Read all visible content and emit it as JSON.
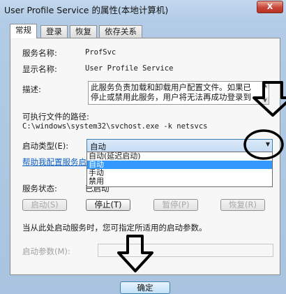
{
  "window": {
    "title": "User Profile Service 的属性(本地计算机)",
    "close_glyph": "X"
  },
  "tabs": [
    {
      "label": "常规",
      "active": true
    },
    {
      "label": "登录",
      "active": false
    },
    {
      "label": "恢复",
      "active": false
    },
    {
      "label": "依存关系",
      "active": false
    }
  ],
  "general": {
    "service_name_label": "服务名称:",
    "service_name_value": "ProfSvc",
    "display_name_label": "显示名称:",
    "display_name_value": "User Profile Service",
    "description_label": "描述:",
    "description_lines": [
      "此服务负责加载和卸载用户配置文件。如果已",
      "停止或禁用此服务，用户将无法再成功登录到"
    ],
    "exe_path_label": "可执行文件的路径:",
    "exe_path_value": "C:\\windows\\system32\\svchost.exe -k netsvcs",
    "startup_type_label": "启动类型(E):",
    "startup_type_value": "自动",
    "startup_options": [
      "自动(延迟启动)",
      "自动",
      "手动",
      "禁用"
    ],
    "startup_highlighted_index": 1,
    "help_link": "帮助我配置服务启动",
    "status_label": "服务状态:",
    "status_value": "已启动",
    "buttons": {
      "start": "启动(S)",
      "stop": "停止(T)",
      "pause": "暂停(P)",
      "resume": "恢复(R)"
    },
    "hint": "当从此处启动服务时，您可指定所适用的启动参数。",
    "params_label": "启动参数(M):",
    "params_value": ""
  },
  "footer": {
    "ok_label": "确定"
  },
  "colors": {
    "highlight": "#3399ff",
    "annotation": "#000000",
    "link": "#0b5fc2"
  }
}
